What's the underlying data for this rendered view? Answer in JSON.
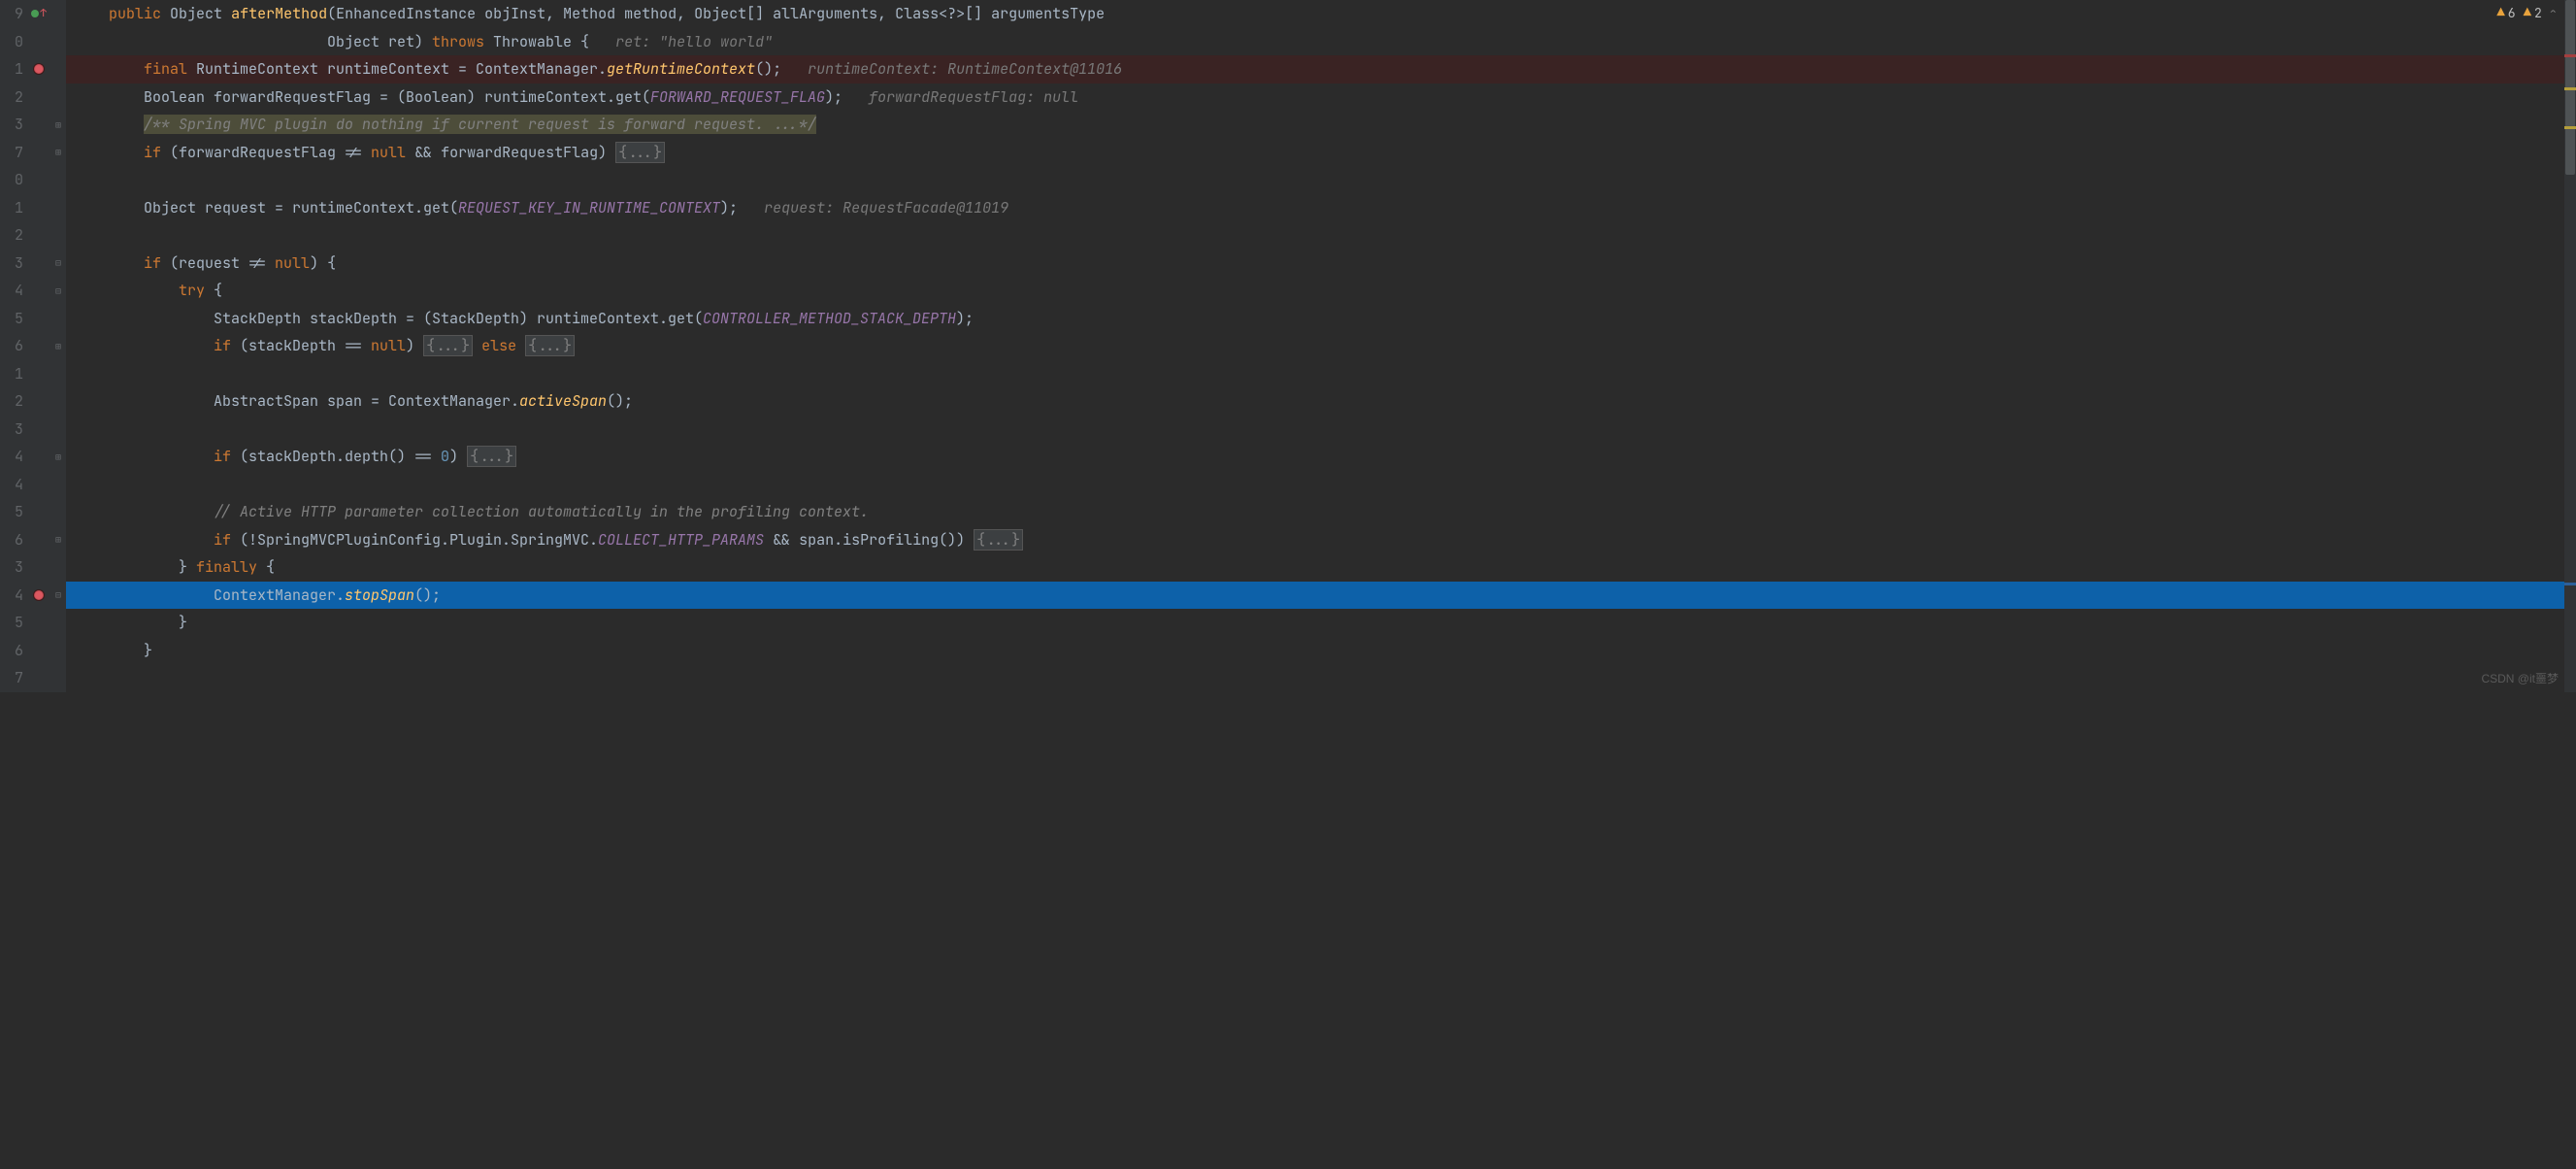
{
  "indicators": {
    "warning_count": "6",
    "weak_warning_count": "2"
  },
  "line_numbers": [
    "9",
    "0",
    "1",
    "2",
    "3",
    "7",
    "0",
    "1",
    "2",
    "3",
    "4",
    "5",
    "6",
    "1",
    "2",
    "3",
    "4",
    "4",
    "5",
    "6",
    "3",
    "4",
    "5",
    "6",
    "7"
  ],
  "code": {
    "l1": {
      "indent": "    ",
      "kw1": "public",
      "sp1": " ",
      "type": "Object ",
      "method": "afterMethod",
      "params": "(EnhancedInstance objInst, Method method, Object[] allArguments, Class<?>[] argumentsType"
    },
    "l2": {
      "indent": "                             ",
      "text": "Object ret) ",
      "kw": "throws",
      "text2": " Throwable {   ",
      "hint": "ret: \"hello world\""
    },
    "l3": {
      "indent": "        ",
      "kw": "final",
      "text1": " RuntimeContext runtimeContext = ContextManager.",
      "method": "getRuntimeContext",
      "text2": "();   ",
      "hint": "runtimeContext: RuntimeContext@11016"
    },
    "l4": {
      "indent": "        ",
      "text1": "Boolean forwardRequestFlag = (Boolean) runtimeContext.get(",
      "const": "FORWARD_REQUEST_FLAG",
      "text2": ");   ",
      "hint": "forwardRequestFlag: null"
    },
    "l5": {
      "indent": "        ",
      "comment": "/** Spring MVC plugin do nothing if current request is forward request. ...*/"
    },
    "l6": {
      "indent": "        ",
      "kw": "if",
      "text1": " (forwardRequestFlag != ",
      "kw2": "null",
      "text2": " && forwardRequestFlag) ",
      "fold": "{...}"
    },
    "l8": {
      "indent": "        ",
      "text1": "Object request = runtimeContext.get(",
      "const": "REQUEST_KEY_IN_RUNTIME_CONTEXT",
      "text2": ");   ",
      "hint": "request: RequestFacade@11019"
    },
    "l10": {
      "indent": "        ",
      "kw": "if",
      "text1": " (request != ",
      "kw2": "null",
      "text2": ") {"
    },
    "l11": {
      "indent": "            ",
      "kw": "try",
      "text": " {"
    },
    "l12": {
      "indent": "                ",
      "text1": "StackDepth stackDepth = (StackDepth) runtimeContext.get(",
      "const": "CONTROLLER_METHOD_STACK_DEPTH",
      "text2": ");"
    },
    "l13": {
      "indent": "                ",
      "kw": "if",
      "text1": " (stackDepth == ",
      "kw2": "null",
      "text2": ") ",
      "fold1": "{...}",
      "sp": " ",
      "kw3": "else",
      "sp2": " ",
      "fold2": "{...}"
    },
    "l15": {
      "indent": "                ",
      "text1": "AbstractSpan span = ContextManager.",
      "method": "activeSpan",
      "text2": "();"
    },
    "l17": {
      "indent": "                ",
      "kw": "if",
      "text1": " (stackDepth.depth() == ",
      "num": "0",
      "text2": ") ",
      "fold": "{...}"
    },
    "l19": {
      "indent": "                ",
      "comment": "// Active HTTP parameter collection automatically in the profiling context."
    },
    "l20": {
      "indent": "                ",
      "kw": "if",
      "text1": " (!SpringMVCPluginConfig.Plugin.SpringMVC.",
      "const": "COLLECT_HTTP_PARAMS",
      "text2": " && span.isProfiling()) ",
      "fold": "{...}"
    },
    "l21": {
      "indent": "            ",
      "text1": "} ",
      "kw": "finally",
      "text2": " {"
    },
    "l22": {
      "indent": "                ",
      "text1": "ContextManager.",
      "method": "stopSpan",
      "text2": "();"
    },
    "l23": {
      "indent": "            ",
      "text": "}"
    },
    "l24": {
      "indent": "        ",
      "text": "}"
    }
  },
  "watermark": "CSDN @it噩梦"
}
